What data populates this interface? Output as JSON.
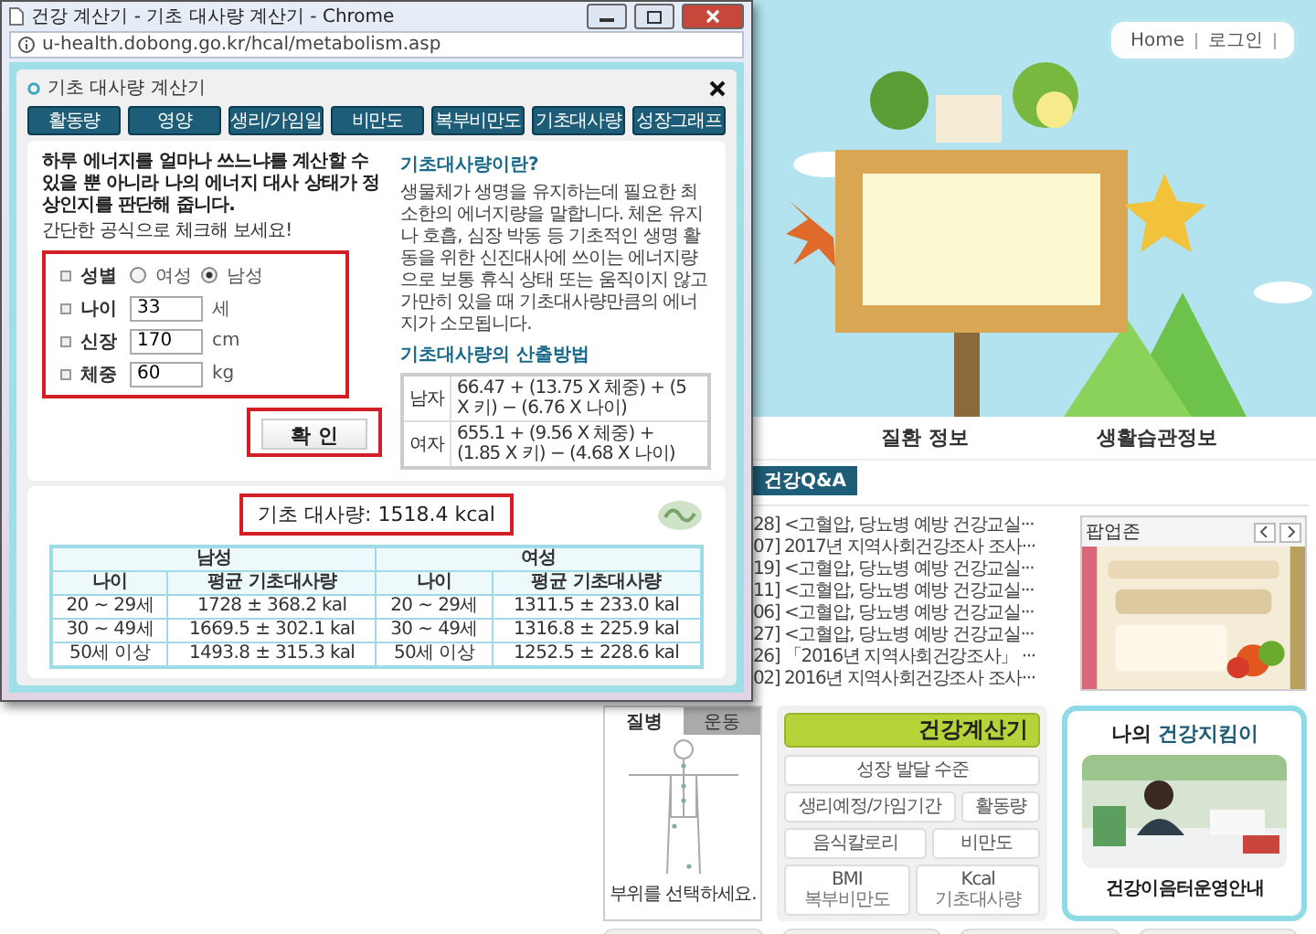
{
  "popup_window": {
    "title": "건강 계산기 - 기초 대사량 계산기 - Chrome",
    "address": "u-health.dobong.go.kr/hcal/metabolism.asp",
    "calculator": {
      "title": "기초 대사량 계산기",
      "tabs": [
        "활동량",
        "영양",
        "생리/가임일",
        "비만도",
        "복부비만도",
        "기초대사량",
        "성장그래프"
      ],
      "intro": "하루 에너지를 얼마나 쓰느냐를 계산할 수 있을 뿐 아니라 나의 에너지 대사 상태가 정상인지를 판단해 줍니다.",
      "intro_note": "간단한 공식으로 체크해 보세요!",
      "fields": [
        {
          "kind": "radio",
          "label": "성별",
          "options": [
            {
              "label": "여성",
              "selected": false
            },
            {
              "label": "남성",
              "selected": true
            }
          ]
        },
        {
          "kind": "text",
          "label": "나이",
          "value": "33",
          "unit": "세"
        },
        {
          "kind": "text",
          "label": "신장",
          "value": "170",
          "unit": "cm"
        },
        {
          "kind": "text",
          "label": "체중",
          "value": "60",
          "unit": "kg"
        }
      ],
      "confirm_button": "확 인",
      "info": {
        "heading": "기초대사량이란?",
        "text": "생물체가 생명을 유지하는데 필요한 최소한의 에너지량을 말합니다. 체온 유지나 호흡, 심장 박동 등 기초적인 생명 활동을 위한 신진대사에 쓰이는 에너지량으로 보통 휴식 상태 또는 움직이지 않고 가만히 있을 때 기초대사량만큼의 에너지가 소모됩니다.",
        "formula_heading": "기초대사량의 산출방법",
        "formulas": [
          {
            "sex": "남자",
            "formula": "66.47 + (13.75 X 체중) + (5 X 키) − (6.76 X 나이)"
          },
          {
            "sex": "여자",
            "formula": "655.1 + (9.56 X 체중) + (1.85 X 키) − (4.68 X 나이)"
          }
        ]
      },
      "result": "기초 대사량: 1518.4 kcal",
      "averages_table": {
        "groups": [
          "남성",
          "여성"
        ],
        "columns": [
          "나이",
          "평균 기초대사량",
          "나이",
          "평균 기초대사량"
        ],
        "rows": [
          [
            "20 ~ 29세",
            "1728 ± 368.2 kal",
            "20 ~ 29세",
            "1311.5 ± 233.0 kal"
          ],
          [
            "30 ~ 49세",
            "1669.5 ± 302.1 kal",
            "30 ~ 49세",
            "1316.8 ± 225.9 kal"
          ],
          [
            "50세 이상",
            "1493.8 ± 315.3 kal",
            "50세 이상",
            "1252.5 ± 228.6 kal"
          ]
        ]
      }
    }
  },
  "page": {
    "account_links": [
      "Home",
      "로그인"
    ],
    "nav": [
      "질환 정보",
      "생활습관정보"
    ],
    "board_tab": "건강Q&A",
    "news": [
      "28] <고혈압, 당뇨병 예방 건강교실···",
      "07] 2017년 지역사회건강조사 조사···",
      "19] <고혈압, 당뇨병 예방 건강교실···",
      "11] <고혈압, 당뇨병 예방 건강교실···",
      "06] <고혈압, 당뇨병 예방 건강교실···",
      "27] <고혈압, 당뇨병 예방 건강교실···",
      "26] 「2016년 지역사회건강조사」 ···",
      "02] 2016년 지역사회건강조사 조사···"
    ],
    "popup_zone": {
      "title": "팝업존"
    },
    "body_panel": {
      "tabs": [
        {
          "label": "질병",
          "selected": true
        },
        {
          "label": "운동",
          "selected": false
        }
      ],
      "hint": "부위를 선택하세요."
    },
    "calculators": {
      "title": "건강계산기",
      "buttons": [
        {
          "label": "성장 발달 수준"
        },
        {
          "label": "생리예정/가임기간"
        },
        {
          "label": "활동량"
        },
        {
          "label": "음식칼로리"
        },
        {
          "label": "비만도"
        },
        {
          "label": "BMI",
          "sub": "복부비만도"
        },
        {
          "label": "Kcal",
          "sub": "기초대사량"
        }
      ]
    },
    "guard_card": {
      "title_lead": "나의",
      "title_emphasis": "건강지킴이",
      "caption": "건강이음터운영안내"
    }
  }
}
